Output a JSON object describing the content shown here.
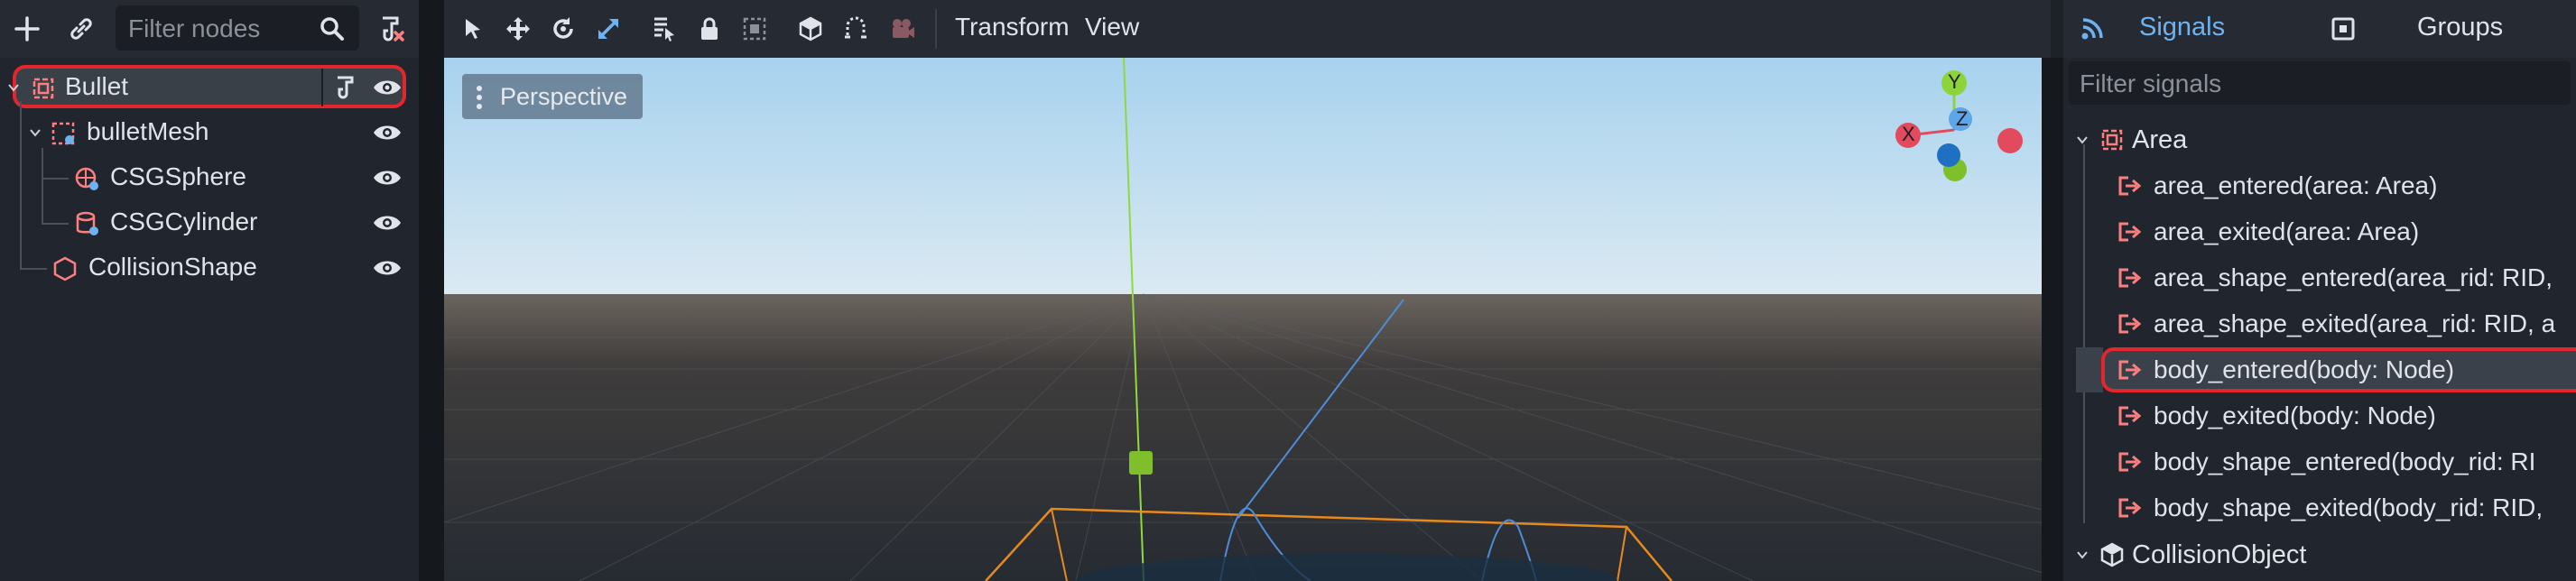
{
  "scene_panel": {
    "filter_placeholder": "Filter nodes",
    "nodes": [
      {
        "name": "Bullet",
        "icon": "area-icon"
      },
      {
        "name": "bulletMesh",
        "icon": "spatial-icon"
      },
      {
        "name": "CSGSphere",
        "icon": "csg-sphere-icon"
      },
      {
        "name": "CSGCylinder",
        "icon": "csg-cylinder-icon"
      },
      {
        "name": "CollisionShape",
        "icon": "collision-shape-icon"
      }
    ]
  },
  "viewport": {
    "menus": {
      "transform": "Transform",
      "view": "View"
    },
    "perspective_label": "Perspective",
    "gizmo": {
      "y": "Y",
      "z": "Z",
      "x": "X"
    }
  },
  "signals_panel": {
    "tabs": {
      "signals": "Signals",
      "groups": "Groups"
    },
    "filter_placeholder": "Filter signals",
    "groups": [
      {
        "name": "Area",
        "signals": [
          "area_entered(area: Area)",
          "area_exited(area: Area)",
          "area_shape_entered(area_rid: RID,",
          "area_shape_exited(area_rid: RID, a",
          "body_entered(body: Node)",
          "body_exited(body: Node)",
          "body_shape_entered(body_rid: RI",
          "body_shape_exited(body_rid: RID,"
        ]
      },
      {
        "name": "CollisionObject",
        "signals": []
      }
    ],
    "selected_signal": "body_entered(body: Node)"
  },
  "colors": {
    "accent_blue": "#6db3f2",
    "highlight_red": "#e3262b",
    "signal_icon_red": "#fc7f7f",
    "node_icon_red": "#fc7f7f",
    "axis_x": "#e24b5e",
    "axis_y": "#8cd43a",
    "axis_z": "#4f8cd6"
  }
}
